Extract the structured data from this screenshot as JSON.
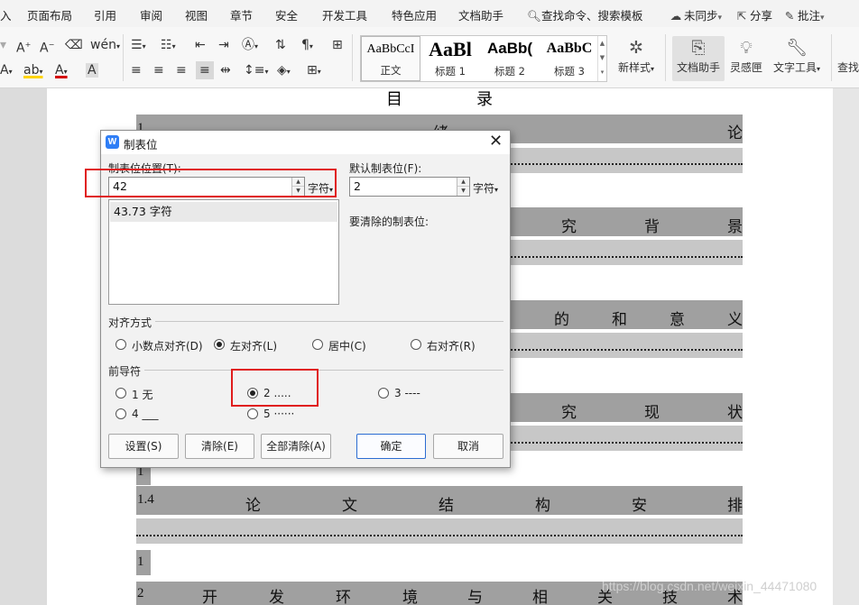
{
  "menubar": {
    "left_fragment": "入",
    "items": [
      "页面布局",
      "引用",
      "审阅",
      "视图",
      "章节",
      "安全",
      "开发工具",
      "特色应用",
      "文档助手"
    ],
    "search": "查找命令、搜索模板",
    "sync": "未同步",
    "share": "分享",
    "comment": "批注"
  },
  "ribbon": {
    "styles": [
      {
        "preview": "AaBbCcI",
        "label": "正文"
      },
      {
        "preview": "AaBl",
        "label": "标题 1"
      },
      {
        "preview": "AaBb(",
        "label": "标题 2"
      },
      {
        "preview": "AaBbC",
        "label": "标题 3"
      }
    ],
    "new_style": "新样式",
    "doc_assistant": "文档助手",
    "inspiration": "灵感匣",
    "text_tools": "文字工具",
    "find_fragment": "查找"
  },
  "document": {
    "toc_title_a": "目",
    "toc_title_b": "录",
    "lines": [
      {
        "num": "1",
        "chars": [
          "绪",
          "论"
        ]
      },
      {
        "chars": [
          "究",
          "背",
          "景"
        ]
      },
      {
        "chars": [
          "的",
          "和",
          "意",
          "义"
        ]
      },
      {
        "chars": [
          "究",
          "现",
          "状"
        ]
      },
      {
        "num": "1"
      },
      {
        "num": "1.4",
        "chars": [
          "论",
          "文",
          "结",
          "构",
          "安",
          "排"
        ]
      },
      {
        "num": "1"
      },
      {
        "num": "2",
        "chars": [
          "开",
          "发",
          "环",
          "境",
          "与",
          "相",
          "关",
          "技",
          "术"
        ]
      }
    ],
    "watermark": "https://blog.csdn.net/weixin_44471080"
  },
  "dialog": {
    "title": "制表位",
    "tab_position_label": "制表位位置(T):",
    "tab_position_value": "42",
    "unit": "字符",
    "list_items": [
      "43.73 字符"
    ],
    "default_tab_label": "默认制表位(F):",
    "default_tab_value": "2",
    "default_unit": "字符",
    "clear_label": "要清除的制表位:",
    "alignment_label": "对齐方式",
    "alignment_options": [
      {
        "label": "小数点对齐(D)",
        "checked": false
      },
      {
        "label": "左对齐(L)",
        "checked": true
      },
      {
        "label": "居中(C)",
        "checked": false
      },
      {
        "label": "右对齐(R)",
        "checked": false
      }
    ],
    "leader_label": "前导符",
    "leader_options": [
      {
        "label": "1 无",
        "checked": false
      },
      {
        "label": "2 .....",
        "checked": true
      },
      {
        "label": "3 ----",
        "checked": false
      },
      {
        "label": "4 ___",
        "checked": false
      },
      {
        "label": "5 ······",
        "checked": false
      }
    ],
    "buttons": {
      "set": "设置(S)",
      "clear": "清除(E)",
      "clear_all": "全部清除(A)",
      "ok": "确定",
      "cancel": "取消"
    }
  },
  "colors": {
    "highlight_red": "#e01c1c",
    "primary_border": "#2b6cd2",
    "app_icon": "#2f7ef6"
  }
}
